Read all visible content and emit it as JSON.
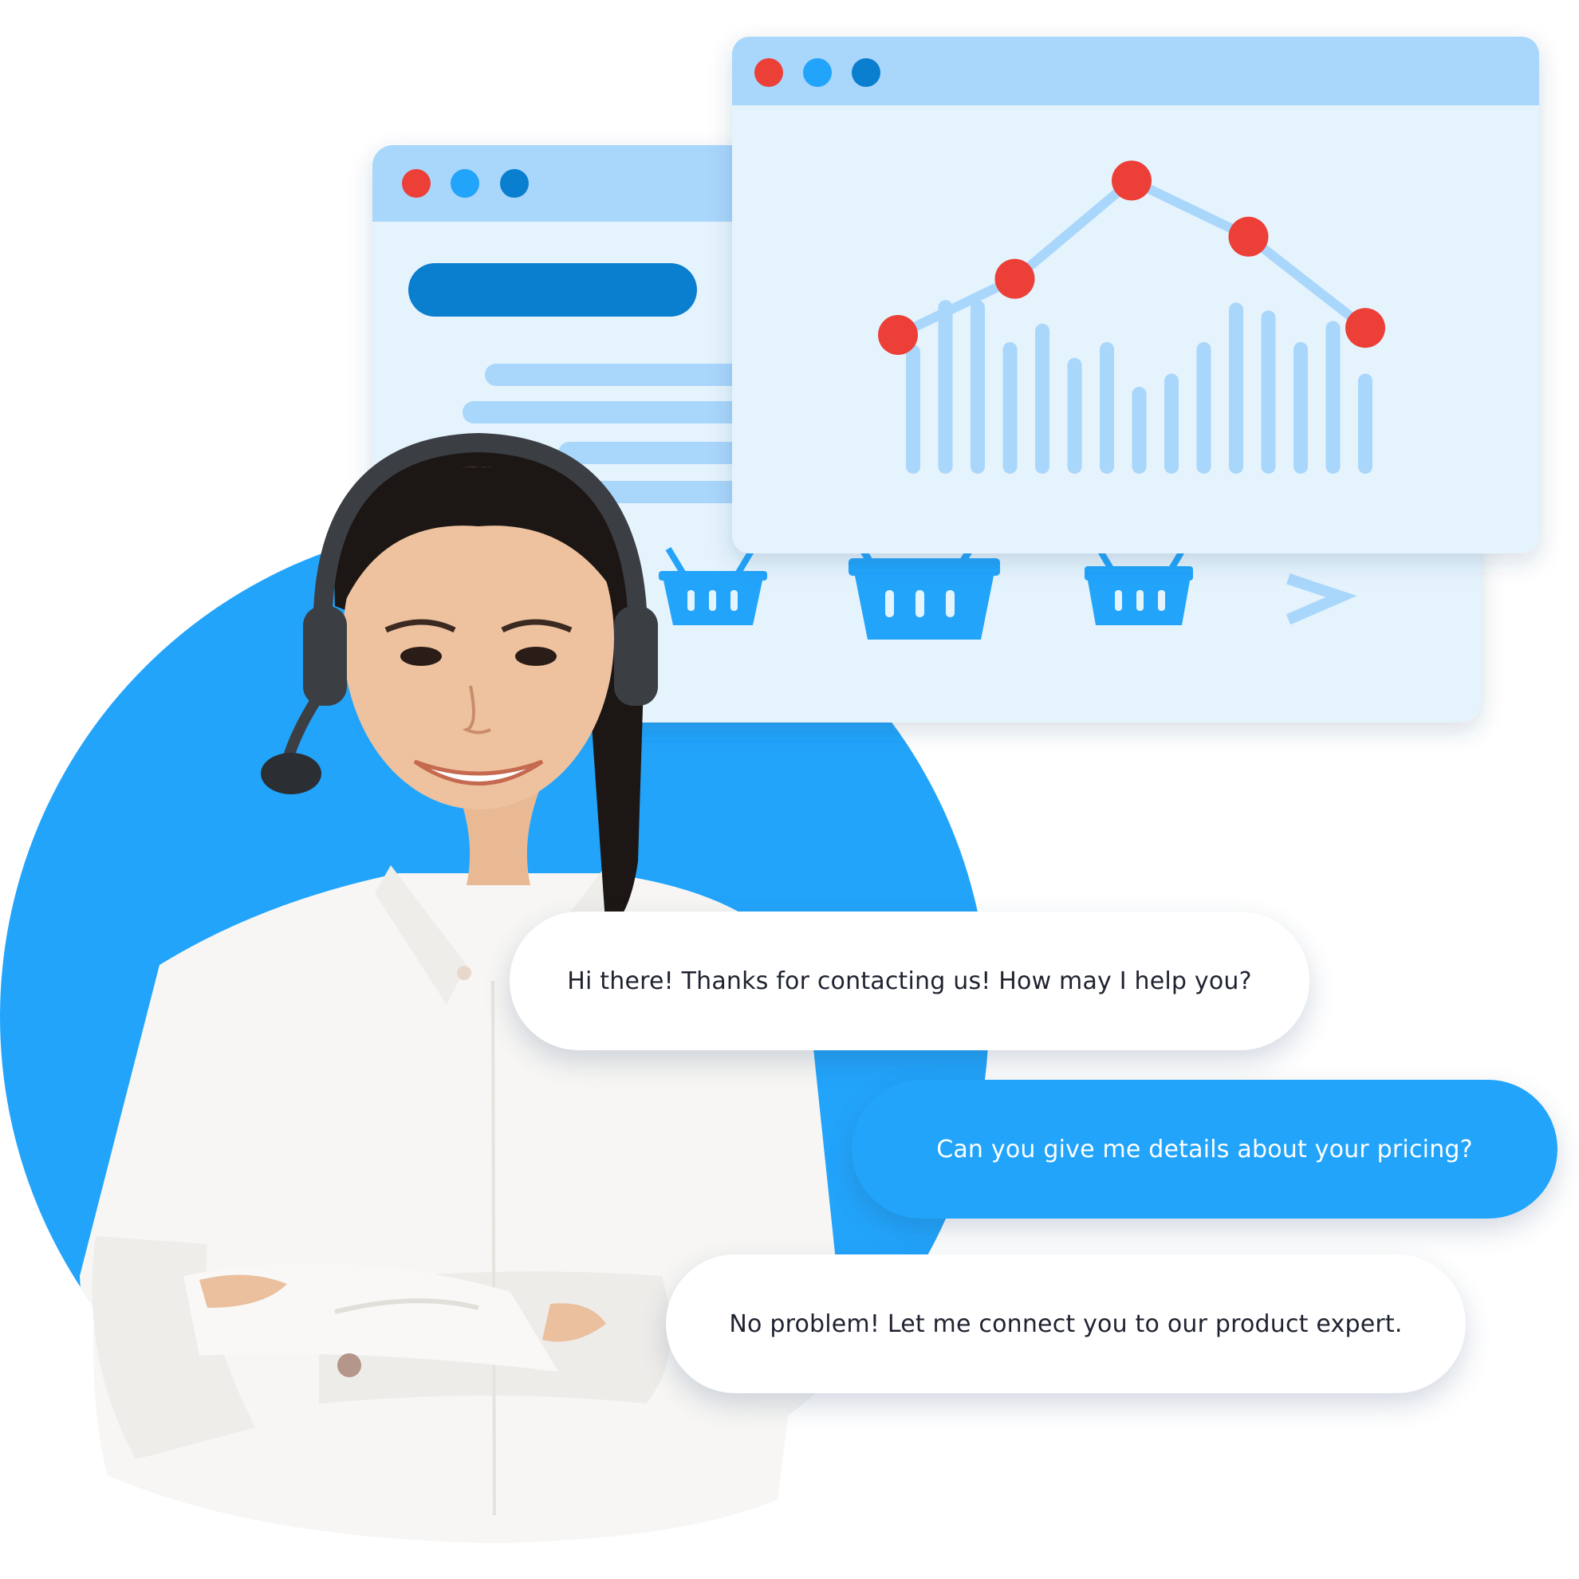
{
  "colors": {
    "primary_blue": "#22a4fb",
    "dark_blue": "#0a7ecf",
    "light_panel": "#e5f3fd",
    "titlebar": "#a9d6fb",
    "chart_line": "#a9d6fb",
    "chart_point": "#ec3f37",
    "dot_red": "#ec3f37",
    "dot_blue": "#22a4fb",
    "dot_dark_blue": "#0a7ecf"
  },
  "illustration": {
    "back_window": {
      "icons": [
        "basket-icon",
        "basket-icon",
        "basket-icon",
        "chevron-right-icon"
      ]
    },
    "front_window": {
      "icons": [
        "line-chart-icon",
        "bar-chart-icon"
      ]
    }
  },
  "chart_data": {
    "type": "line",
    "x": [
      1,
      2,
      3,
      4,
      5
    ],
    "y": [
      2,
      3.6,
      6.4,
      4.8,
      2.2
    ],
    "bars": [
      4.9,
      6.6,
      6.6,
      5.0,
      5.7,
      4.4,
      5.0,
      3.3,
      3.8,
      5.0,
      6.5,
      6.2,
      5.0,
      5.8,
      3.8
    ],
    "title": "",
    "xlabel": "",
    "ylabel": ""
  },
  "chat": {
    "messages": [
      {
        "role": "agent",
        "text": "Hi there! Thanks for contacting us! How may I help you?"
      },
      {
        "role": "user",
        "text": "Can you give me details about your pricing?"
      },
      {
        "role": "agent",
        "text": "No problem! Let me connect you to our product expert."
      }
    ]
  }
}
